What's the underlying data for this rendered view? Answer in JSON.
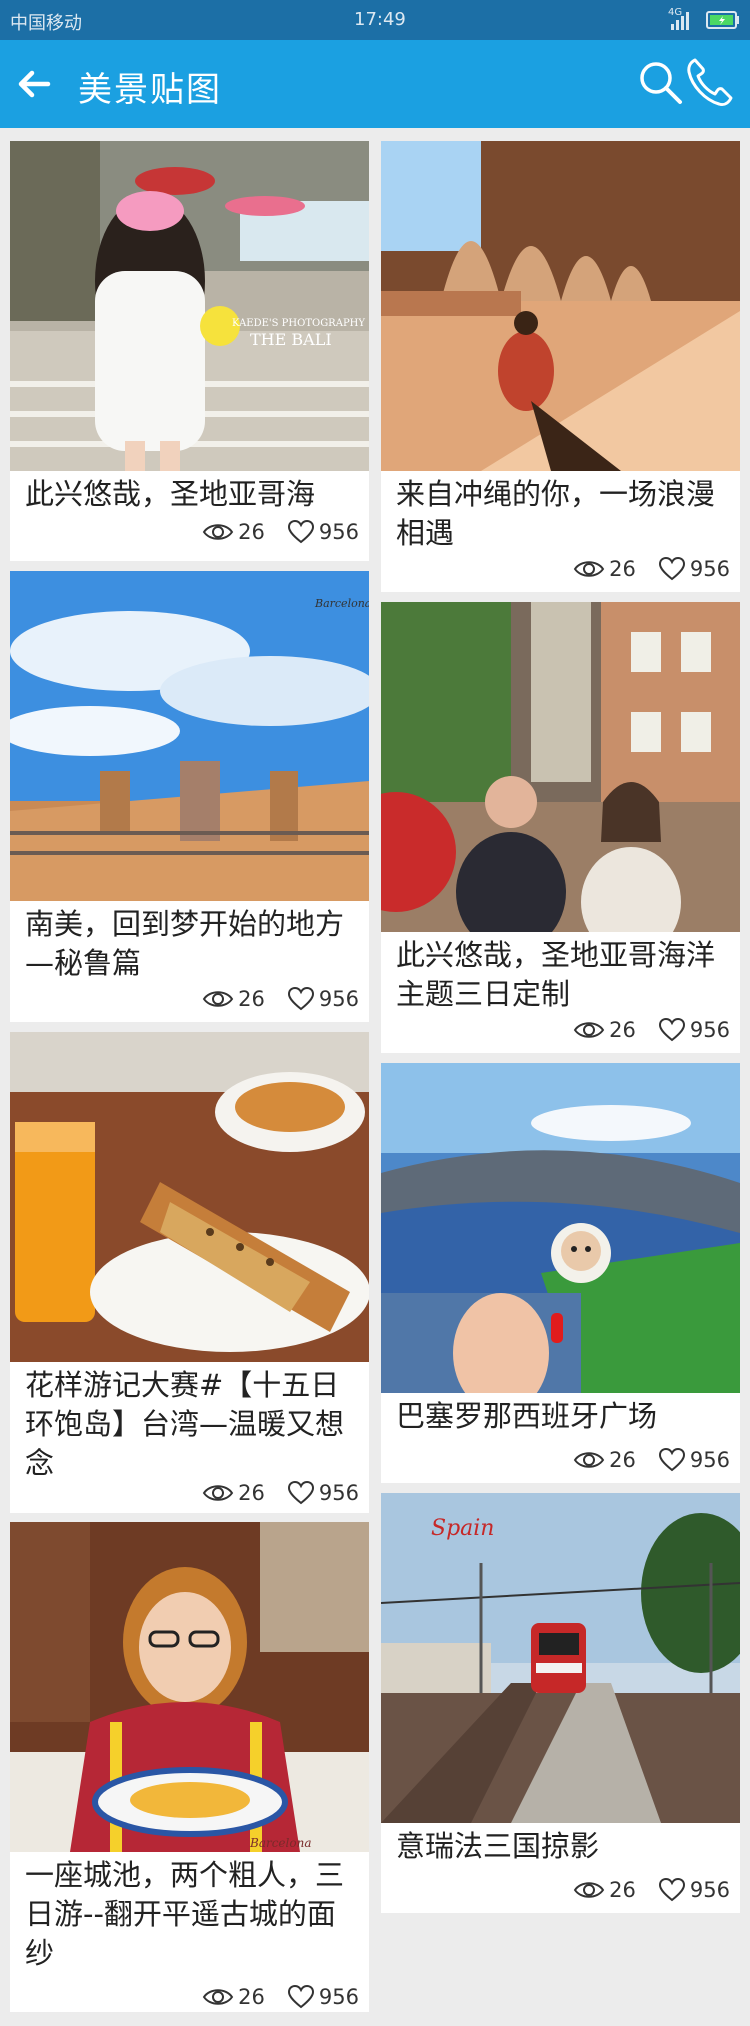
{
  "status_bar": {
    "carrier": "中国移动",
    "time": "17:49",
    "network": "4G"
  },
  "app_bar": {
    "title": "美景贴图",
    "back_icon": "arrow-left-icon",
    "search_icon": "search-icon",
    "phone_icon": "phone-icon"
  },
  "colors": {
    "status_bar": "#1c6fa6",
    "app_bar": "#1ba0e1",
    "background": "#ececec"
  },
  "cards": [
    {
      "caption": "此兴悠哉，圣地亚哥海",
      "views": "26",
      "likes": "956",
      "photo_text": [
        "KAEDE'S PHOTOGRAPHY",
        "THE BALI"
      ]
    },
    {
      "caption": "来自冲绳的你，一场浪漫相遇",
      "views": "26",
      "likes": "956"
    },
    {
      "caption": "南美，回到梦开始的地方—秘鲁篇",
      "views": "26",
      "likes": "956",
      "photo_text": [
        "Barcelona"
      ]
    },
    {
      "caption": "此兴悠哉，圣地亚哥海洋主题三日定制",
      "views": "26",
      "likes": "956"
    },
    {
      "caption": "花样游记大赛#【十五日环饱岛】台湾—温暖又想念",
      "views": "26",
      "likes": "956"
    },
    {
      "caption": "巴塞罗那西班牙广场",
      "views": "26",
      "likes": "956"
    },
    {
      "caption": "一座城池，两个粗人，三日游--翻开平遥古城的面纱",
      "views": "26",
      "likes": "956",
      "photo_text": [
        "Barcelona"
      ]
    },
    {
      "caption": "意瑞法三国掠影",
      "views": "26",
      "likes": "956",
      "photo_text": [
        "Spain"
      ]
    }
  ]
}
